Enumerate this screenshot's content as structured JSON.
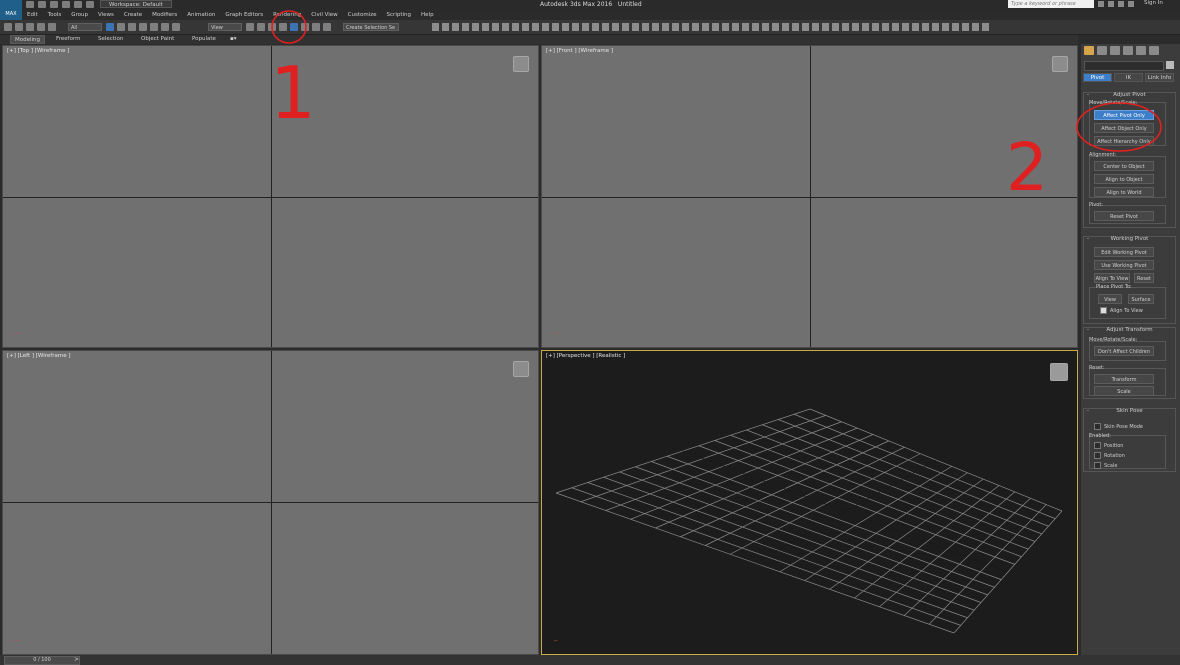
{
  "title": {
    "app": "Autodesk 3ds Max 2016",
    "doc": "Untitled",
    "workspace": "Workspace: Default",
    "search_placeholder": "Type a keyword or phrase",
    "sign_in": "Sign In",
    "logo_text": "MAX"
  },
  "menu": [
    "Edit",
    "Tools",
    "Group",
    "Views",
    "Create",
    "Modifiers",
    "Animation",
    "Graph Editors",
    "Rendering",
    "Civil View",
    "Customize",
    "Scripting",
    "Help"
  ],
  "toolbar": {
    "filter_value": "All",
    "ref_coord_value": "View",
    "selection_set_placeholder": "Create Selection Se"
  },
  "ribbon": {
    "tabs": [
      "Modeling",
      "Freeform",
      "Selection",
      "Object Paint",
      "Populate"
    ]
  },
  "viewports": {
    "top": {
      "label": "[+] [Top ] [Wireframe ]"
    },
    "front": {
      "label": "[+] [Front ] [Wireframe ]"
    },
    "left": {
      "label": "[+] [Left ] [Wireframe ]"
    },
    "persp": {
      "label": "[+] [Perspective ] [Realistic ]"
    }
  },
  "timeline": {
    "position": "0 / 100",
    "next": ">"
  },
  "panel": {
    "subtabs": [
      "Pivot",
      "IK",
      "Link Info"
    ],
    "adjust_pivot": {
      "title": "Adjust Pivot",
      "move_label": "Move/Rotate/Scale:",
      "buttons": [
        "Affect Pivot Only",
        "Affect Object Only",
        "Affect Hierarchy Only"
      ],
      "alignment_label": "Alignment:",
      "align_buttons": [
        "Center to Object",
        "Align to Object",
        "Align to World"
      ],
      "pivot_label": "Pivot:",
      "reset": "Reset Pivot"
    },
    "working_pivot": {
      "title": "Working Pivot",
      "edit": "Edit Working Pivot",
      "use": "Use Working Pivot",
      "align_to_view": "Align To View",
      "reset": "Reset",
      "place_label": "Place Pivot To:",
      "view": "View",
      "surface": "Surface",
      "align_check": "Align To View"
    },
    "adjust_transform": {
      "title": "Adjust Transform",
      "move_label": "Move/Rotate/Scale:",
      "dont_affect": "Don't Affect Children",
      "reset_label": "Reset:",
      "transform": "Transform",
      "scale": "Scale"
    },
    "skin_pose": {
      "title": "Skin Pose",
      "mode": "Skin Pose Mode",
      "enabled_label": "Enabled:",
      "checks": [
        "Position",
        "Rotation",
        "Scale"
      ]
    }
  },
  "annotations": {
    "one": "1",
    "two": "2",
    "color": "#e02020"
  },
  "colors": {
    "accent": "#3d7ec8",
    "persp_border": "#c9a94a"
  }
}
